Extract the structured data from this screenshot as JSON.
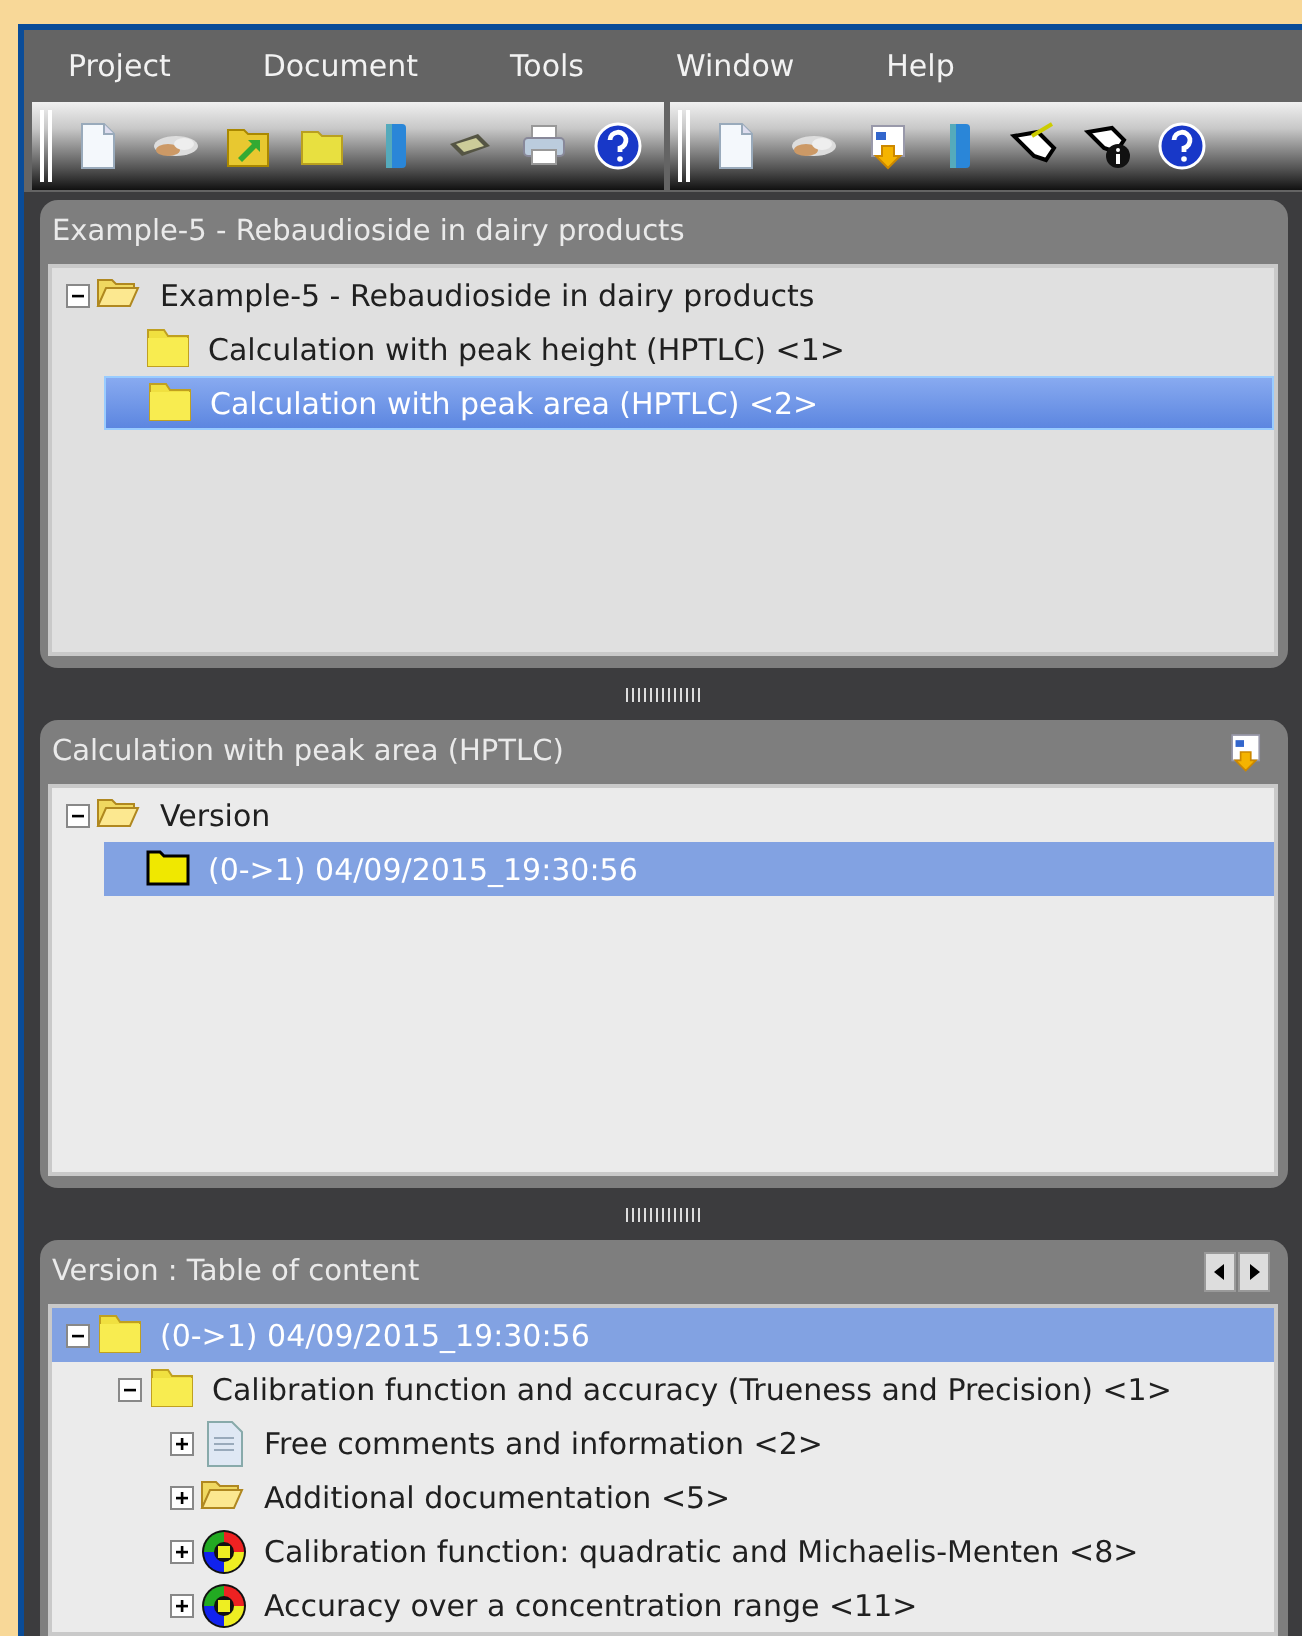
{
  "menu": [
    {
      "label": "Project"
    },
    {
      "label": "Document"
    },
    {
      "label": "Tools"
    },
    {
      "label": "Window"
    },
    {
      "label": "Help"
    }
  ],
  "panels": [
    {
      "title": "Example-5 - Rebaudioside in dairy products",
      "tree": [
        {
          "label": "Example-5 - Rebaudioside in dairy products",
          "kind": "folder-open",
          "expanded": true,
          "selected": false,
          "children": [
            {
              "label": "Calculation with peak height (HPTLC) <1>",
              "kind": "folder",
              "selected": false
            },
            {
              "label": "Calculation with peak area (HPTLC) <2>",
              "kind": "folder",
              "selected": true
            }
          ]
        }
      ]
    },
    {
      "title": "Calculation with peak area (HPTLC)",
      "header_control": {
        "kind": "import"
      },
      "tree": [
        {
          "label": "Version",
          "kind": "folder-open",
          "expanded": true,
          "selected": false,
          "children": [
            {
              "label": "(0->1) 04/09/2015_19:30:56",
              "kind": "folder-flat",
              "selected": true
            }
          ]
        }
      ]
    },
    {
      "title": "Version : Table of content",
      "header_control": {
        "kind": "arrows"
      },
      "tree": [
        {
          "label": "(0->1) 04/09/2015_19:30:56",
          "kind": "folder",
          "expanded": true,
          "selected": true,
          "children": [
            {
              "label": "Calibration function and accuracy (Trueness and Precision) <1>",
              "kind": "folder",
              "expanded": true,
              "selected": false,
              "children": [
                {
                  "label": "Free comments and information <2>",
                  "kind": "document",
                  "expanded": false,
                  "selected": false
                },
                {
                  "label": "Additional documentation <5>",
                  "kind": "folder-open",
                  "expanded": false,
                  "selected": false
                },
                {
                  "label": "Calibration function: quadratic and Michaelis-Menten <8>",
                  "kind": "module",
                  "expanded": false,
                  "selected": false
                },
                {
                  "label": "Accuracy over a concentration range <11>",
                  "kind": "module",
                  "expanded": false,
                  "selected": false
                }
              ]
            }
          ]
        }
      ]
    }
  ]
}
